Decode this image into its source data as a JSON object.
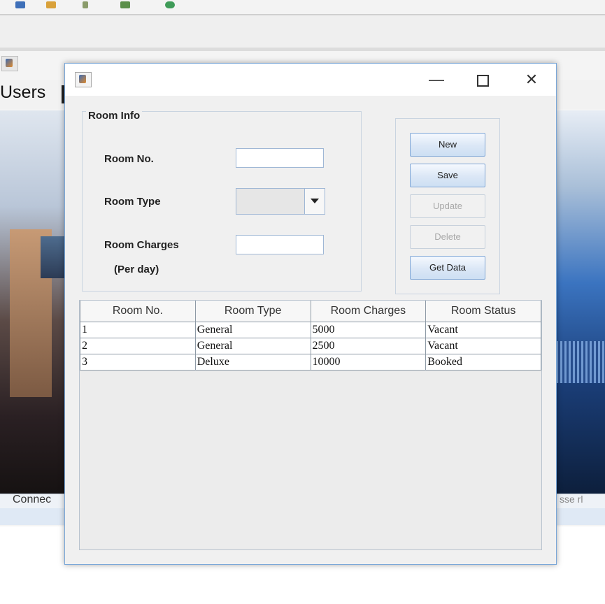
{
  "app": {
    "menu_first": "Users",
    "status_left": "Connec",
    "status_right": "sse rl"
  },
  "dialog": {
    "title_min": "—",
    "title_close": "✕",
    "room_info": {
      "legend": "Room Info",
      "room_no_label": "Room No.",
      "room_type_label": "Room Type",
      "room_charges_label": "Room Charges",
      "per_day_label": "(Per day)",
      "room_no_value": "",
      "room_type_value": "",
      "room_charges_value": ""
    },
    "buttons": {
      "new": "New",
      "save": "Save",
      "update": "Update",
      "delete": "Delete",
      "get_data": "Get Data"
    },
    "table": {
      "headers": [
        "Room No.",
        "Room Type",
        "Room Charges",
        "Room Status"
      ],
      "rows": [
        [
          "1",
          "General",
          "5000",
          "Vacant"
        ],
        [
          "2",
          "General",
          "2500",
          "Vacant"
        ],
        [
          "3",
          "Deluxe",
          "10000",
          "Booked"
        ]
      ]
    }
  }
}
